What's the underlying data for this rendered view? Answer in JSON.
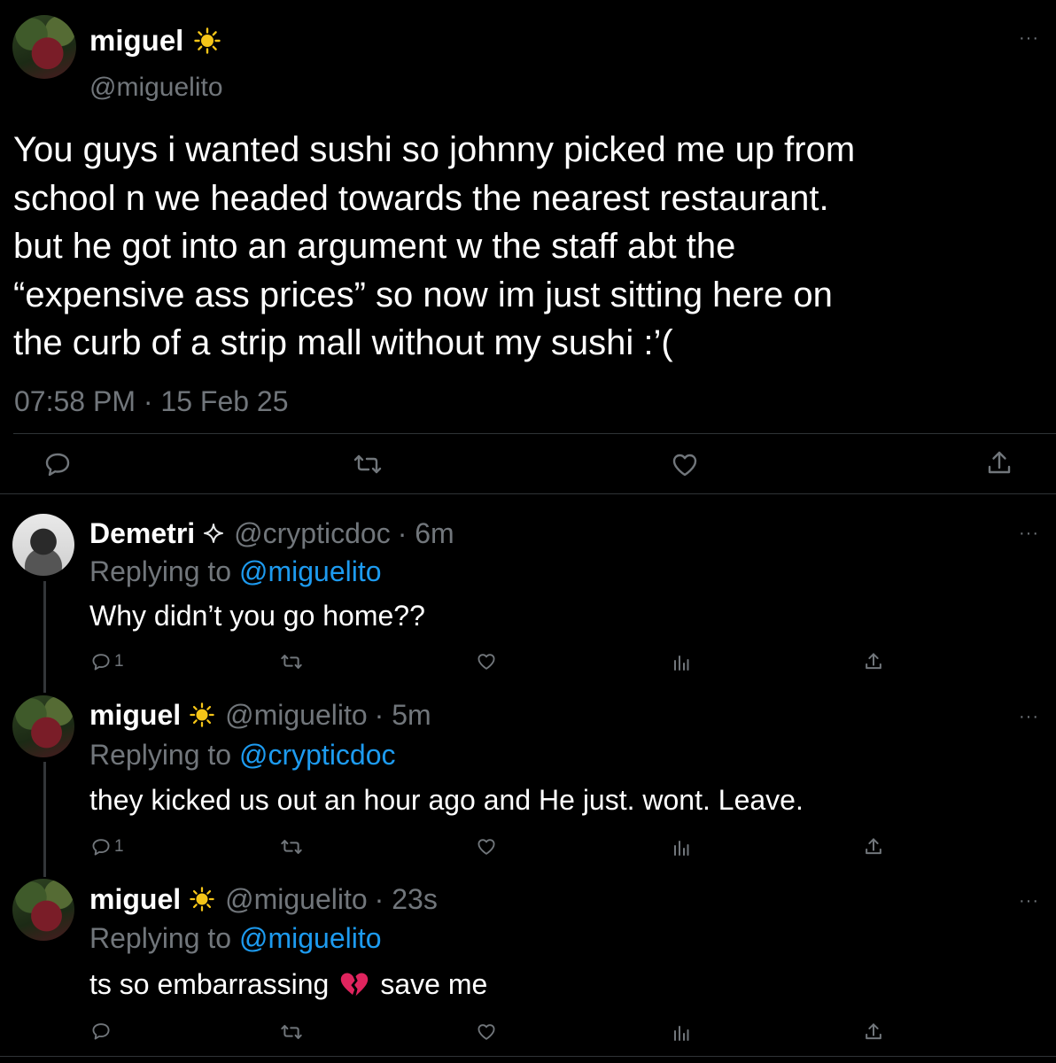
{
  "main_tweet": {
    "display_name": "miguel",
    "badge": "sun-emoji",
    "handle": "@miguelito",
    "text_lines": [
      "You guys i wanted sushi so johnny picked me up from",
      "school n we headed towards the nearest restaurant.",
      "but he got into an argument w the staff abt the",
      "“expensive ass prices” so now im just sitting here on",
      "the curb of a strip mall without my sushi :’("
    ],
    "timestamp": "07:58 PM · 15 Feb 25",
    "more": "···"
  },
  "replies": [
    {
      "display_name": "Demetri",
      "badge": "sparkle-icon",
      "handle": "@crypticdoc",
      "time": "· 6m",
      "replying_prefix": "Replying to",
      "replying_to": "@miguelito",
      "text": "Why didn’t you go home??",
      "reply_count": "1",
      "more": "···"
    },
    {
      "display_name": "miguel",
      "badge": "sun-emoji",
      "handle": "@miguelito",
      "time": "· 5m",
      "replying_prefix": "Replying to",
      "replying_to": "@crypticdoc",
      "text": "they kicked us out an hour ago and He just. wont. Leave.",
      "reply_count": "1",
      "more": "···"
    },
    {
      "display_name": "miguel",
      "badge": "sun-emoji",
      "handle": "@miguelito",
      "time": "· 23s",
      "replying_prefix": "Replying to",
      "replying_to": "@miguelito",
      "text_before_emoji": "ts so embarrassing",
      "emoji": "broken-heart-emoji",
      "text_after_emoji": "save me",
      "reply_count": "",
      "more": "···"
    }
  ],
  "colors": {
    "background": "#000000",
    "text": "#e7e9ea",
    "secondary": "#71767b",
    "link": "#1d9bf0",
    "divider": "#2f3336",
    "sun": "#f5c518",
    "broken_heart": "#e0245e"
  }
}
